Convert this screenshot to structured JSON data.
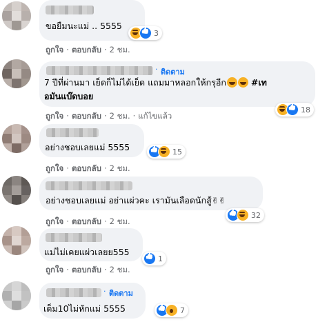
{
  "actions": {
    "like": "ถูกใจ",
    "reply": "ตอบกลับ",
    "edited": "แก้ไขแล้ว"
  },
  "comments": [
    {
      "follow": "",
      "text": "ขอยืมนะแม่ .. 5555",
      "time": "2 ชม.",
      "reaction_count": "3"
    },
    {
      "follow": "ติดตาม",
      "text": "7 ปีที่ผ่านมา เย็ดก็ไม่ได้เย็ด แถมมาหลอกให้กรุอีก",
      "hashtag_1": "#เท",
      "hashtag_2": "อมันแบ๊ดบอย",
      "time": "2 ชม.",
      "reaction_count": "18"
    },
    {
      "follow": "",
      "text": "อย่างชอบเลยแม่ 5555",
      "time": "2 ชม.",
      "reaction_count": "15"
    },
    {
      "follow": "",
      "text": "อย่างชอบเลยแม่ อย่าแผ่วคะ เรามันเลือดนักสู้",
      "time": "2 ชม.",
      "reaction_count": "32"
    },
    {
      "follow": "",
      "text": "แม่ไม่เคยแผ่วเลยย555",
      "time": "2 ชม.",
      "reaction_count": "1"
    },
    {
      "follow": "ติดตาม",
      "text": "เต็ม10ไม่หักแม่ 5555",
      "time": "",
      "reaction_count": "7"
    }
  ],
  "colors": {
    "bubble": "#f0f2f5",
    "link": "#1876f2",
    "meta": "#65676b",
    "like": "#1877f2",
    "haha": "#f7b125"
  },
  "icons": [
    "haha-reaction-icon",
    "like-reaction-icon",
    "wow-reaction-icon",
    "victory-hand-icon"
  ]
}
